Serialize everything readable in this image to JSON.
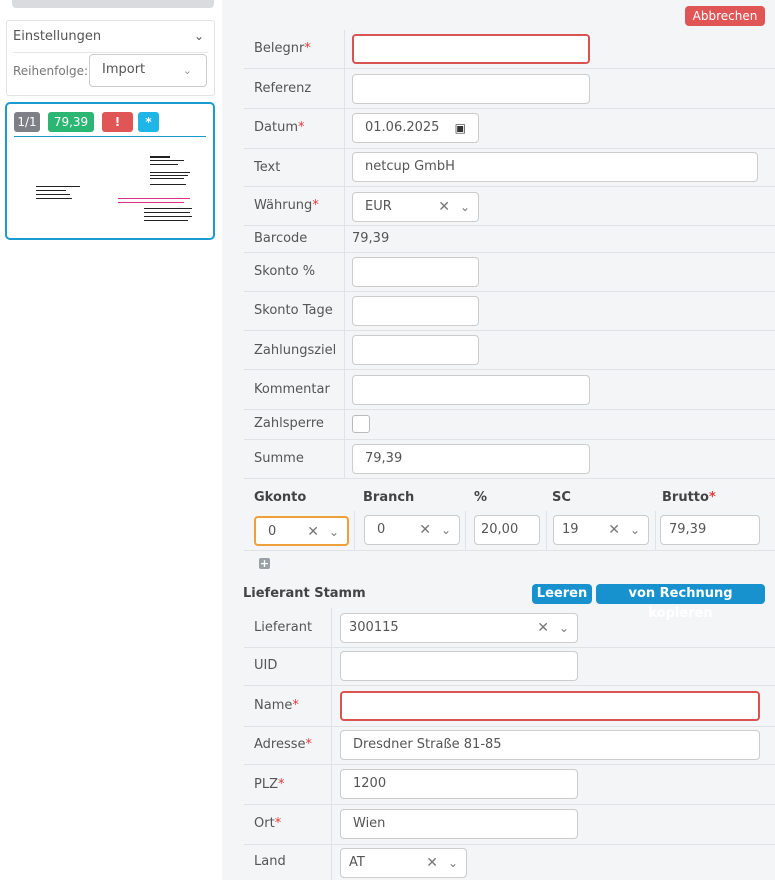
{
  "sidebar": {
    "settings_title": "Einstellungen",
    "order_label": "Reihenfolge:",
    "order_value": "Import",
    "card": {
      "page": "1/1",
      "amount": "79,39",
      "warn_icon": "!",
      "star_icon": "*"
    }
  },
  "form": {
    "cancel_label": "Abbrechen",
    "fields": {
      "belegnr": {
        "label": "Belegnr",
        "value": ""
      },
      "referenz": {
        "label": "Referenz",
        "value": ""
      },
      "datum": {
        "label": "Datum",
        "value": "01.06.2025"
      },
      "text": {
        "label": "Text",
        "value": "netcup GmbH"
      },
      "waehrung": {
        "label": "Währung",
        "value": "EUR"
      },
      "barcode": {
        "label": "Barcode",
        "value": "79,39"
      },
      "skonto_pct": {
        "label": "Skonto %",
        "value": ""
      },
      "skonto_tage": {
        "label": "Skonto Tage",
        "value": ""
      },
      "zahlungsziel": {
        "label": "Zahlungsziel",
        "value": ""
      },
      "kommentar": {
        "label": "Kommentar",
        "value": ""
      },
      "zahlsperre": {
        "label": "Zahlsperre"
      },
      "summe": {
        "label": "Summe",
        "value": "79,39"
      }
    },
    "lines": {
      "headers": {
        "gkonto": "Gkonto",
        "branch": "Branch",
        "pct": "%",
        "sc": "SC",
        "brutto": "Brutto"
      },
      "row": {
        "gkonto": "0",
        "branch": "0",
        "pct": "20,00",
        "sc": "19",
        "brutto": "79,39"
      }
    },
    "supplier": {
      "section_title": "Lieferant Stamm",
      "clear_label": "Leeren",
      "copy_label": "von Rechnung kopieren",
      "lieferant": {
        "label": "Lieferant",
        "value": "300115"
      },
      "uid": {
        "label": "UID",
        "value": ""
      },
      "name": {
        "label": "Name",
        "value": ""
      },
      "adresse": {
        "label": "Adresse",
        "value": "Dresdner Straße 81-85"
      },
      "plz": {
        "label": "PLZ",
        "value": "1200"
      },
      "ort": {
        "label": "Ort",
        "value": "Wien"
      },
      "land": {
        "label": "Land",
        "value": "AT"
      }
    }
  }
}
